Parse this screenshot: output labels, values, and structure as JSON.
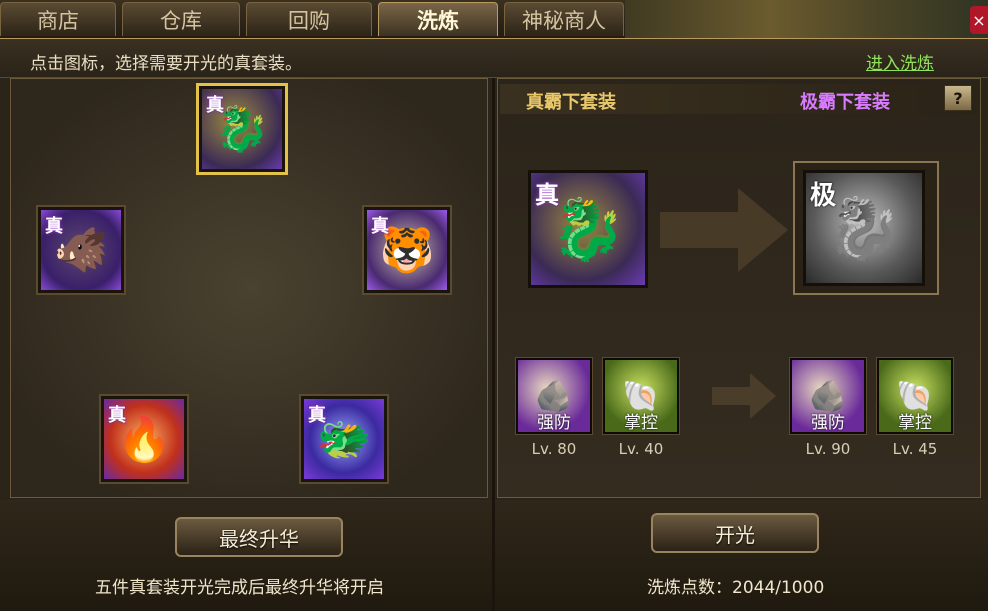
{
  "tabs": [
    {
      "label": "商店"
    },
    {
      "label": "仓库"
    },
    {
      "label": "回购"
    },
    {
      "label": "洗炼"
    },
    {
      "label": "神秘商人"
    }
  ],
  "hint": "点击图标，选择需要开光的真套装。",
  "enter_link": "进入洗炼",
  "close_icon": "×",
  "equipment_slots": [
    {
      "badge": "真",
      "icon": "dragon-warrior-icon",
      "glyph": "🐉",
      "selected": true
    },
    {
      "badge": "真",
      "icon": "beast-icon",
      "glyph": "🐗",
      "selected": false
    },
    {
      "badge": "真",
      "icon": "tiger-icon",
      "glyph": "🐯",
      "selected": false
    },
    {
      "badge": "真",
      "icon": "phoenix-icon",
      "glyph": "🔥",
      "selected": false
    },
    {
      "badge": "真",
      "icon": "ice-dragon-icon",
      "glyph": "🐲",
      "selected": false
    }
  ],
  "final_button": "最终升华",
  "bottom_note": "五件真套装开光完成后最终升华将开启",
  "right": {
    "current_title": "真霸下套装",
    "target_title": "极霸下套装",
    "help": "?",
    "current_badge": "真",
    "target_badge": "极",
    "skills_before": [
      {
        "name": "强防",
        "level": "Lv. 80",
        "icon": "shield-skill-icon",
        "glyph": "🪨"
      },
      {
        "name": "掌控",
        "level": "Lv. 40",
        "icon": "control-skill-icon",
        "glyph": "🐚"
      }
    ],
    "skills_after": [
      {
        "name": "强防",
        "level": "Lv. 90",
        "icon": "shield-skill-icon",
        "glyph": "🪨"
      },
      {
        "name": "掌控",
        "level": "Lv. 45",
        "icon": "control-skill-icon",
        "glyph": "🐚"
      }
    ],
    "open_button": "开光",
    "points_label": "洗炼点数：",
    "points_value": "2044/1000"
  },
  "colors": {
    "gold": "#e3c24a",
    "purple": "#d87bff",
    "green_link": "#8fe35b"
  }
}
